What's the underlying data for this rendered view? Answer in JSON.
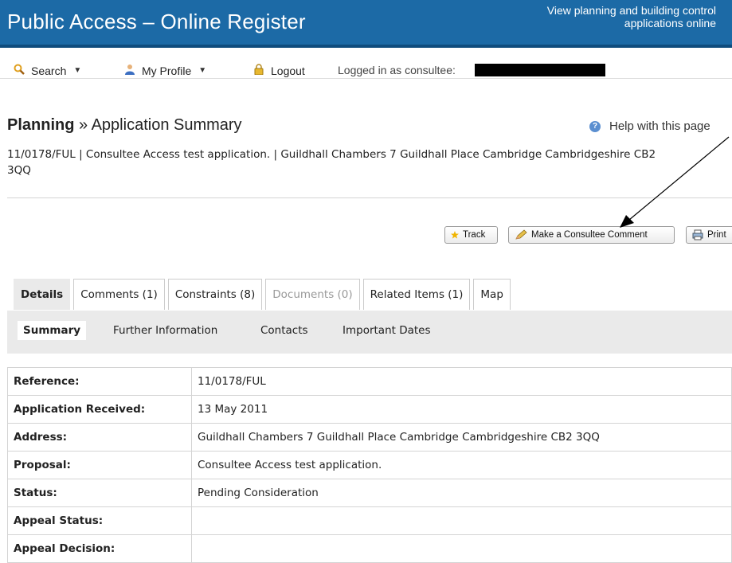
{
  "header": {
    "title": "Public Access – Online Register",
    "tagline": "View planning and building control applications online"
  },
  "toolbar": {
    "search_label": "Search",
    "profile_label": "My Profile",
    "logout_label": "Logout",
    "logged_in_text": "Logged in as consultee:"
  },
  "page": {
    "section": "Planning",
    "separator": "»",
    "subtitle": "Application Summary",
    "help_label": "Help with this page",
    "description": "11/0178/FUL | Consultee Access test application. | Guildhall Chambers 7 Guildhall Place Cambridge Cambridgeshire CB2 3QQ"
  },
  "actions": {
    "track_label": "Track",
    "comment_label": "Make a Consultee Comment",
    "print_label": "Print"
  },
  "tabs": [
    {
      "label": "Details"
    },
    {
      "label": "Comments (1)"
    },
    {
      "label": "Constraints (8)"
    },
    {
      "label": "Documents (0)"
    },
    {
      "label": "Related Items (1)"
    },
    {
      "label": "Map"
    }
  ],
  "subtabs": [
    {
      "label": "Summary"
    },
    {
      "label": "Further Information"
    },
    {
      "label": "Contacts"
    },
    {
      "label": "Important Dates"
    }
  ],
  "summary_rows": [
    {
      "label": "Reference:",
      "value": "11/0178/FUL"
    },
    {
      "label": "Application Received:",
      "value": "13 May 2011"
    },
    {
      "label": "Address:",
      "value": "Guildhall Chambers 7 Guildhall Place Cambridge Cambridgeshire CB2 3QQ"
    },
    {
      "label": "Proposal:",
      "value": "Consultee Access test application."
    },
    {
      "label": "Status:",
      "value": "Pending Consideration"
    },
    {
      "label": "Appeal Status:",
      "value": ""
    },
    {
      "label": "Appeal Decision:",
      "value": ""
    }
  ],
  "colors": {
    "header_bg": "#1c6aa6",
    "active_tab_bg": "#eaeaea"
  }
}
